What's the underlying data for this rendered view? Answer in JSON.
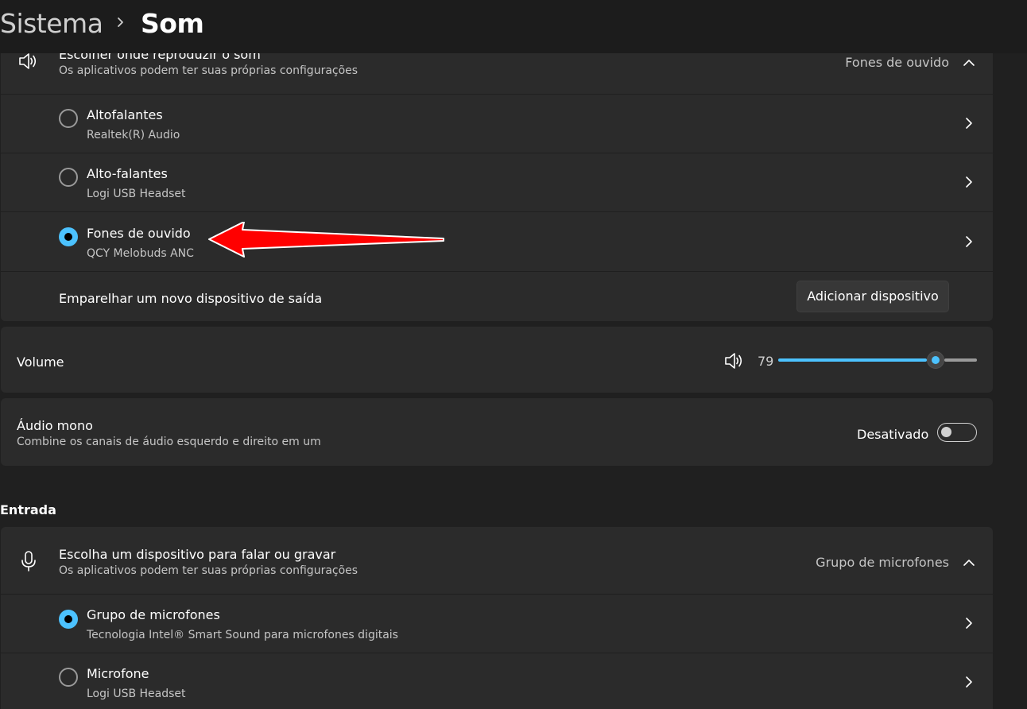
{
  "breadcrumb": {
    "parent": "Sistema",
    "current": "Som"
  },
  "output": {
    "header": {
      "title": "Escolher onde reproduzir o som",
      "subtitle": "Os aplicativos podem ter suas próprias configurações",
      "selected": "Fones de ouvido"
    },
    "devices": [
      {
        "name": "Altofalantes",
        "detail": "Realtek(R) Audio",
        "selected": false
      },
      {
        "name": "Alto-falantes",
        "detail": "Logi USB Headset",
        "selected": false
      },
      {
        "name": "Fones de ouvido",
        "detail": "QCY Melobuds ANC",
        "selected": true
      }
    ],
    "pair": {
      "label": "Emparelhar um novo dispositivo de saída",
      "button": "Adicionar dispositivo"
    }
  },
  "volume": {
    "label": "Volume",
    "value": "79",
    "level": 0.79
  },
  "mono": {
    "title": "Áudio mono",
    "subtitle": "Combine os canais de áudio esquerdo e direito em um",
    "state": "Desativado",
    "on": false
  },
  "input": {
    "section": "Entrada",
    "header": {
      "title": "Escolha um dispositivo para falar ou gravar",
      "subtitle": "Os aplicativos podem ter suas próprias configurações",
      "selected": "Grupo de microfones"
    },
    "devices": [
      {
        "name": "Grupo de microfones",
        "detail": "Tecnologia Intel® Smart Sound para microfones digitais",
        "selected": true
      },
      {
        "name": "Microfone",
        "detail": "Logi USB Headset",
        "selected": false
      }
    ]
  },
  "colors": {
    "accent": "#4cc2ff",
    "annotation_arrow": "#ff0000"
  },
  "icons": [
    "speaker-icon",
    "chevron-right-icon",
    "chevron-up-icon",
    "microphone-icon"
  ]
}
